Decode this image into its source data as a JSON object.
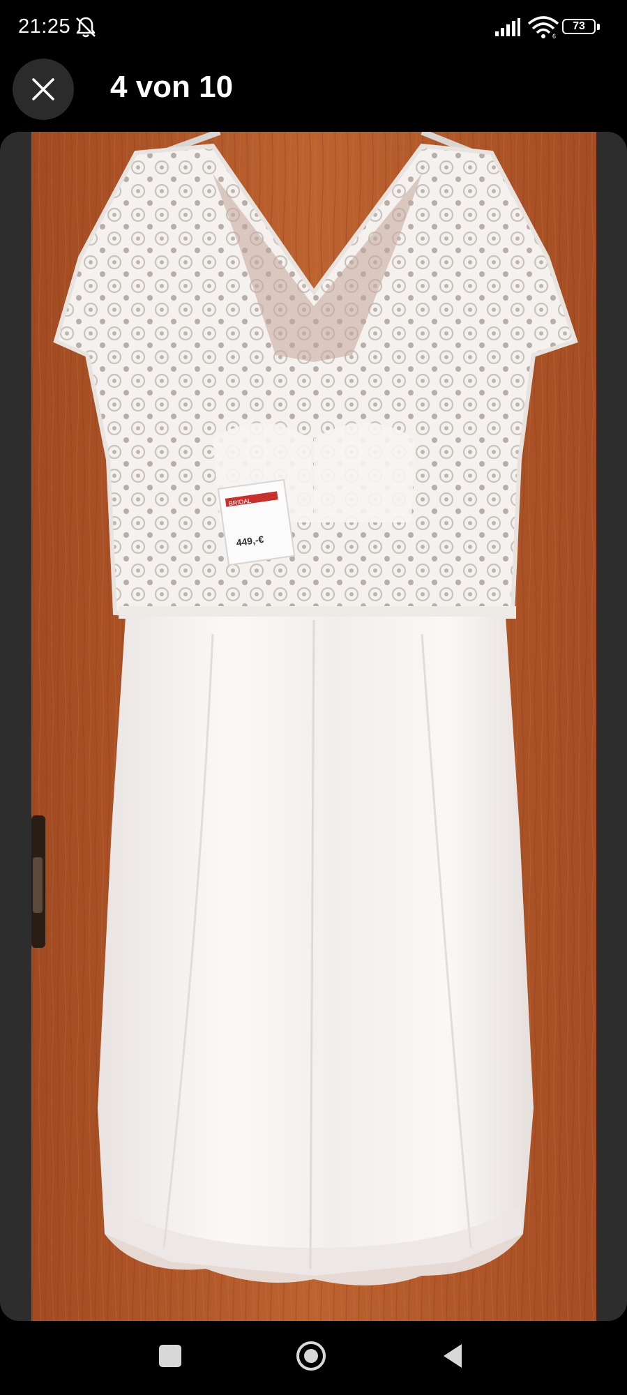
{
  "status_bar": {
    "time": "21:25",
    "battery_level": "73",
    "icons": [
      "mute-icon",
      "signal-icon",
      "wifi-icon",
      "battery-icon"
    ]
  },
  "viewer": {
    "counter": "4 von 10",
    "close_icon": "close-icon"
  },
  "photo": {
    "tag_price": "449,-€",
    "tag_brand": "BRIDAL"
  },
  "nav_bar": {
    "icons": [
      "recents-icon",
      "home-icon",
      "back-icon"
    ]
  },
  "colors": {
    "background": "#000000",
    "frame": "#2d2d2d",
    "door": "#b4582a",
    "dress": "#f7f4f3"
  }
}
